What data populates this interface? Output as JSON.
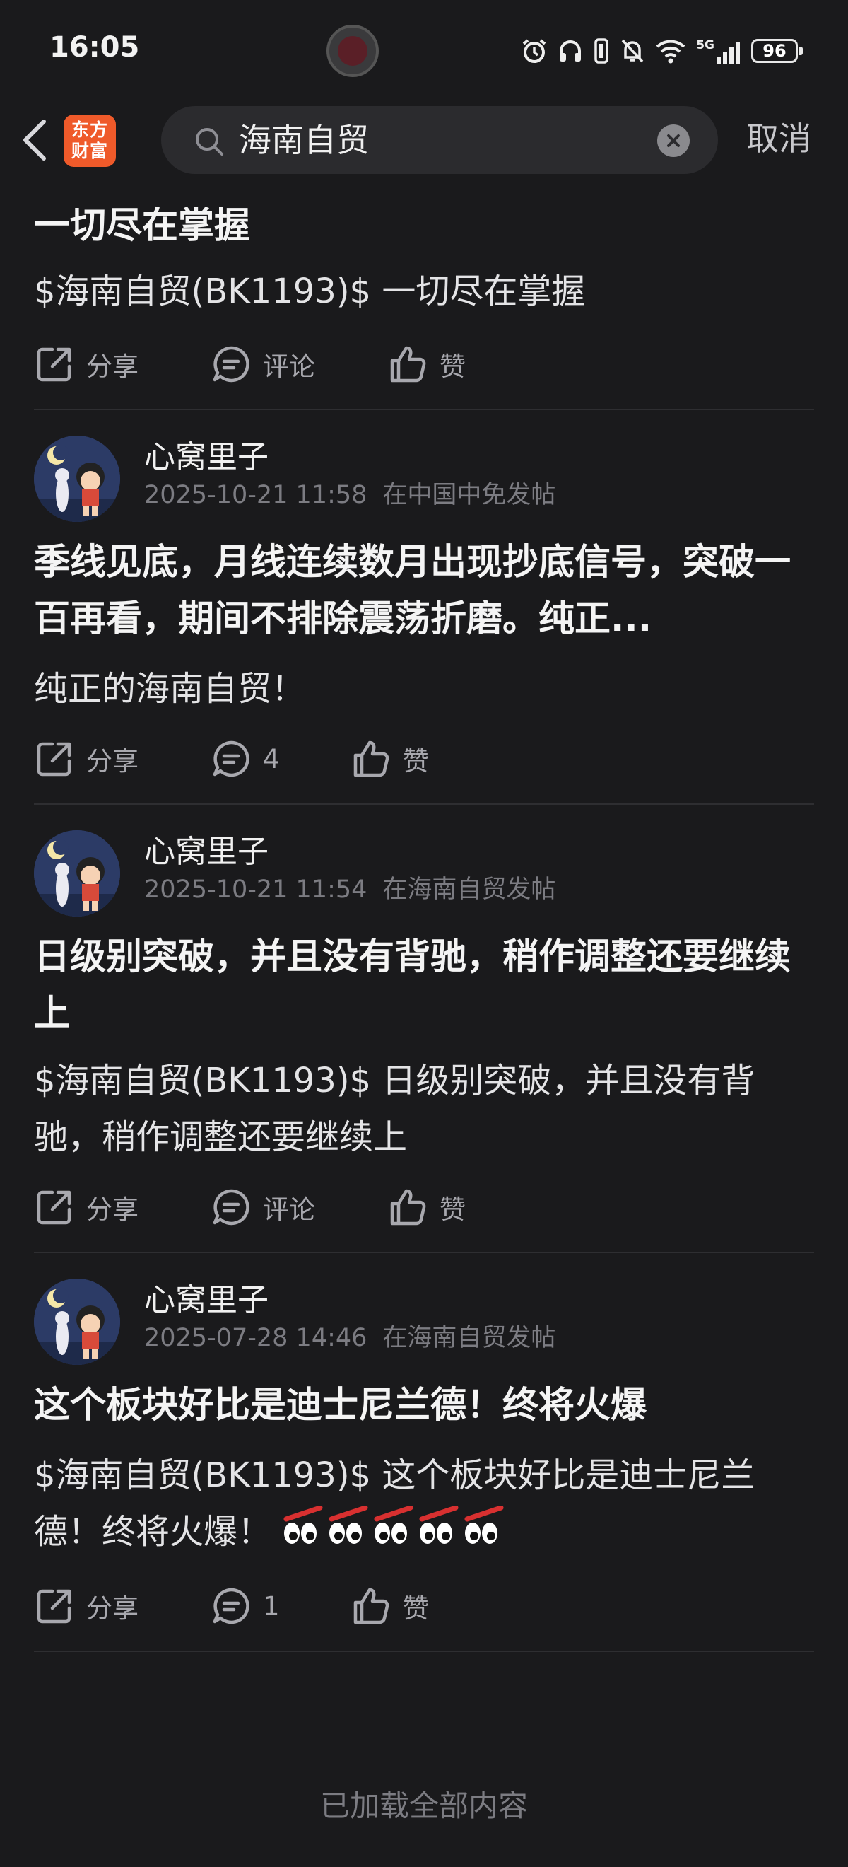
{
  "status_bar": {
    "time": "16:05",
    "network": "5G",
    "battery": "96",
    "icons": [
      "alarm-icon",
      "headphones-icon",
      "vibrate-icon",
      "mute-icon",
      "wifi-icon",
      "signal-icon",
      "battery-icon"
    ]
  },
  "header": {
    "back_icon": "chevron-left-icon",
    "app_logo": {
      "line1": "东方",
      "line2": "财富",
      "color": "#ef5a2a"
    },
    "search": {
      "value": "海南自贸",
      "icon": "search-icon",
      "clear_icon": "clear-icon"
    },
    "cancel_label": "取消"
  },
  "actions": {
    "share_label": "分享",
    "comment_label": "评论",
    "like_label": "赞"
  },
  "posts": [
    {
      "title": "一切尽在掌握",
      "body": "$海南自贸(BK1193)$ 一切尽在掌握",
      "comments": "评论"
    },
    {
      "author": "心窝里子",
      "time": "2025-10-21 11:58",
      "location": "在中国中免发帖",
      "title": "季线见底，月线连续数月出现抄底信号，突破一百再看，期间不排除震荡折磨。纯正...",
      "body": "纯正的海南自贸！",
      "comments": "4"
    },
    {
      "author": "心窝里子",
      "time": "2025-10-21 11:54",
      "location": "在海南自贸发帖",
      "title": "日级别突破，并且没有背驰，稍作调整还要继续上",
      "body": "$海南自贸(BK1193)$ 日级别突破，并且没有背驰，稍作调整还要继续上",
      "comments": "评论"
    },
    {
      "author": "心窝里子",
      "time": "2025-07-28 14:46",
      "location": "在海南自贸发帖",
      "title": "这个板块好比是迪士尼兰德！终将火爆",
      "body": "$海南自贸(BK1193)$ 这个板块好比是迪士尼兰德！终将火爆！",
      "comments": "1"
    }
  ],
  "footer": "已加载全部内容"
}
